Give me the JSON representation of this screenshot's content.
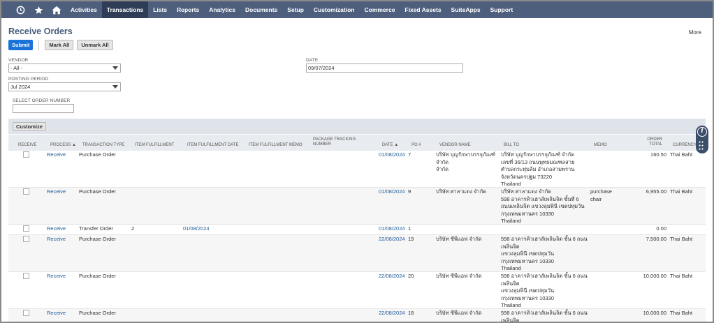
{
  "nav": {
    "items": [
      "Activities",
      "Transactions",
      "Lists",
      "Reports",
      "Analytics",
      "Documents",
      "Setup",
      "Customization",
      "Commerce",
      "Fixed Assets",
      "SuiteApps",
      "Support"
    ],
    "active": "Transactions"
  },
  "page": {
    "title": "Receive Orders",
    "more": "More"
  },
  "buttons": {
    "submit": "Submit",
    "mark_all": "Mark All",
    "unmark_all": "Unmark All",
    "customize": "Customize"
  },
  "filters": {
    "vendor_label": "VENDOR",
    "vendor_value": "- All -",
    "date_label": "DATE",
    "date_value": "09/07/2024",
    "posting_period_label": "POSTING PERIOD",
    "posting_period_value": "Jul 2024",
    "order_number_label": "SELECT ORDER NUMBER",
    "order_number_value": ""
  },
  "columns": {
    "receive": "RECEIVE",
    "process": "PROCESS ▲",
    "transaction_type": "TRANSACTION TYPE",
    "item_fulfillment": "ITEM FULFILLMENT",
    "item_fulfillment_date": "ITEM FULFILLMENT DATE",
    "item_fulfillment_memo": "ITEM FULFILLMENT MEMO",
    "package_tracking_1": "PACKAGE TRACKING",
    "package_tracking_2": "NUMBER",
    "date": "DATE ▲",
    "po": "PO #",
    "vendor_name": "VENDOR NAME",
    "bill_to": "BILL TO",
    "memo": "MEMO",
    "order_total_1": "ORDER",
    "order_total_2": "TOTAL",
    "currency": "CURRENCY"
  },
  "rows": [
    {
      "process": "Receive",
      "type": "Purchase Order",
      "fulfillment": "",
      "fulfillment_date": "",
      "date": "01/08/2024",
      "po": "7",
      "vendor": [
        "บริษัท บุญรักษาบรรจุภัณฑ์ จำกัด",
        "จำกัด"
      ],
      "bill_to": [
        "บริษัท บุญรักษาบรรจุภัณฑ์ จำกัด",
        "เลขที่ 36/13 ถนนพุทธมณฑลสาย",
        "ตำบลกระทุ่มล้ม อำเภอสามพราน",
        "จังหวัดนครปฐม 73220",
        "Thailand"
      ],
      "memo": [],
      "total": "160.50",
      "currency": "Thai Baht"
    },
    {
      "process": "Receive",
      "type": "Purchase Order",
      "fulfillment": "",
      "fulfillment_date": "",
      "date": "01/08/2024",
      "po": "9",
      "vendor": [
        "บริษัท ศาลาแดง จำกัด"
      ],
      "bill_to": [
        "บริษัท ศาลาแดง จำกัด",
        "598 อาคารคิวเฮาส์เพลินจิต ชั้นที่ 6",
        "ถนนเพลินจิต แขวงลุมพินี เขตปทุมวัน",
        "กรุงเทพมหานคร 10330",
        "Thailand"
      ],
      "memo": [
        "purchase",
        "chair"
      ],
      "total": "6,955.00",
      "currency": "Thai Baht"
    },
    {
      "process": "Receive",
      "type": "Transfer Order",
      "fulfillment": "2",
      "fulfillment_date": "01/08/2024",
      "date": "01/08/2024",
      "po": "1",
      "vendor": [],
      "bill_to": [],
      "memo": [],
      "total": "0.00",
      "currency": ""
    },
    {
      "process": "Receive",
      "type": "Purchase Order",
      "fulfillment": "",
      "fulfillment_date": "",
      "date": "22/08/2024",
      "po": "19",
      "vendor": [
        "บริษัท ซีพีแอฟ จำกัด"
      ],
      "bill_to": [
        "598 อาคารคิวเฮาส์เพลินจิต ชั้น 6 ถนน",
        "เพลินจิต",
        "แขวงลุมพินี เขตปทุมวัน",
        "กรุงเทพมหานคร 10330",
        "Thailand"
      ],
      "memo": [],
      "total": "7,500.00",
      "currency": "Thai Baht"
    },
    {
      "process": "Receive",
      "type": "Purchase Order",
      "fulfillment": "",
      "fulfillment_date": "",
      "date": "22/08/2024",
      "po": "20",
      "vendor": [
        "บริษัท ซีพีแอฟ จำกัด"
      ],
      "bill_to": [
        "598 อาคารคิวเฮาส์เพลินจิต ชั้น 6 ถนน",
        "เพลินจิต",
        "แขวงลุมพินี เขตปทุมวัน",
        "กรุงเทพมหานคร 10330",
        "Thailand"
      ],
      "memo": [],
      "total": "10,000.00",
      "currency": "Thai Baht"
    },
    {
      "process": "Receive",
      "type": "Purchase Order",
      "fulfillment": "",
      "fulfillment_date": "",
      "date": "22/08/2024",
      "po": "18",
      "vendor": [
        "บริษัท ซีพีแอฟ จำกัด"
      ],
      "bill_to": [
        "598 อาคารคิวเฮาส์เพลินจิต ชั้น 6 ถนน",
        "เพลินจิต"
      ],
      "memo": [],
      "total": "10,000.00",
      "currency": "Thai Baht"
    }
  ]
}
